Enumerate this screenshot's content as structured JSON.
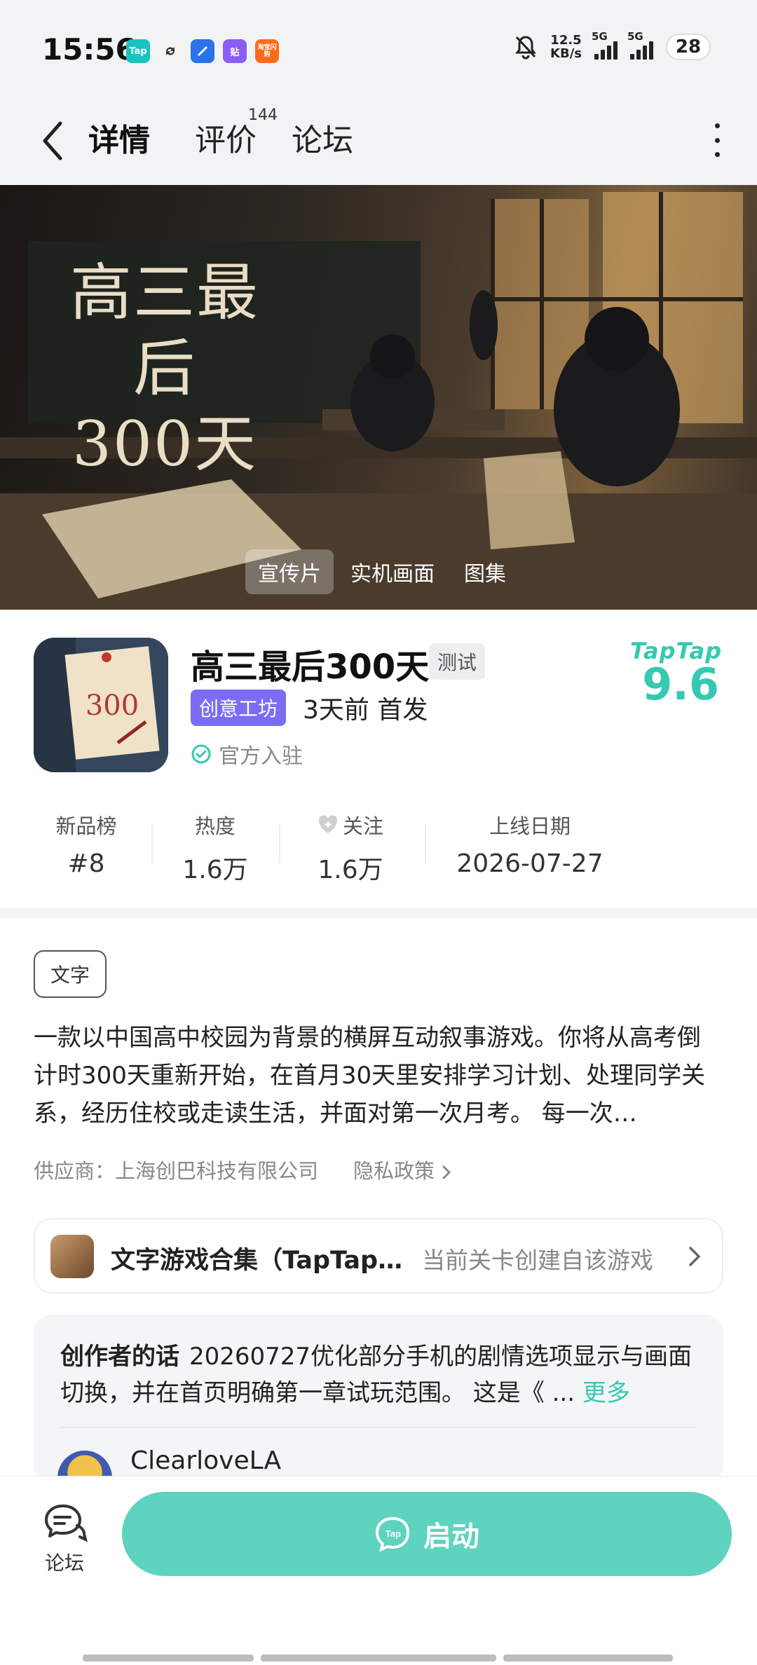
{
  "status_bar": {
    "time": "15:56",
    "net_speed_value": "12.5",
    "net_speed_unit": "KB/s",
    "signal_label_1": "5G",
    "signal_label_2": "5G",
    "battery": "28",
    "app_badges": [
      "Tap",
      "",
      "",
      "贴",
      "淘宝闪购"
    ]
  },
  "nav": {
    "tab_detail": "详情",
    "tab_review": "评价",
    "tab_review_count": "144",
    "tab_forum": "论坛"
  },
  "banner": {
    "title_line1": "高三最后",
    "title_line2": "300天",
    "media_tabs": [
      "宣传片",
      "实机画面",
      "图集"
    ],
    "active_media_tab": "宣传片"
  },
  "game": {
    "icon_text": "300",
    "title": "高三最后300天",
    "beta_badge": "测试",
    "category_tag": "创意工坊",
    "release_info": "3天前 首发",
    "official_label": "官方入驻",
    "rating_brand": "TapTap",
    "rating": "9.6"
  },
  "stats": [
    {
      "label": "新品榜",
      "value": "#8"
    },
    {
      "label": "热度",
      "value": "1.6万"
    },
    {
      "label": "关注",
      "value": "1.6万"
    },
    {
      "label": "上线日期",
      "value": "2026-07-27"
    }
  ],
  "genre_tag": "文字",
  "description": "一款以中国高中校园为背景的横屏互动叙事游戏。你将从高考倒计时300天重新开始，在首月30天里安排学习计划、处理同学关系，经历住校或走读生活，并面对第一次月考。 每一次…",
  "supplier": "供应商：上海创巴科技有限公司",
  "privacy": "隐私政策",
  "collection": {
    "title": "文字游戏合集（TapTap…",
    "status": "当前关卡创建自该游戏"
  },
  "creator": {
    "label": "创作者的话",
    "text": "20260727优化部分手机的剧情选项显示与画面切换，并在首页明确第一章试玩范围。 这是《 ...",
    "more": "更多",
    "author": "ClearloveLA"
  },
  "bottom": {
    "forum_label": "论坛",
    "launch_label": "启动"
  },
  "colors": {
    "accent": "#35c9b1",
    "launch_bg": "#5ed3bf",
    "tag_purple": "#7b6cf6"
  }
}
